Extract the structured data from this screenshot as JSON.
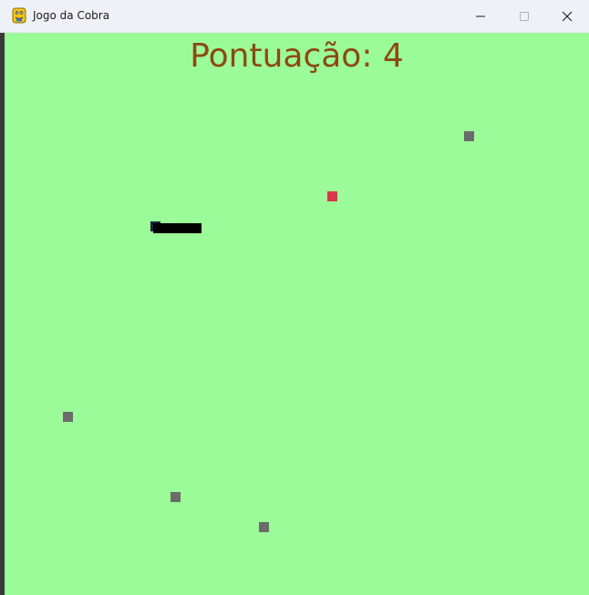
{
  "window": {
    "title": "Jogo da Cobra",
    "icon": "python-snake-icon",
    "controls": [
      "minimize-icon",
      "maximize-icon",
      "close-icon"
    ]
  },
  "game": {
    "score_label": "Pontuação: 4",
    "background_color": "#9bfb98",
    "score_color": "#8b4a12",
    "snake_color": "#000000",
    "food_color": "#d9374c",
    "obstacle_color": "#6b6b6b"
  }
}
